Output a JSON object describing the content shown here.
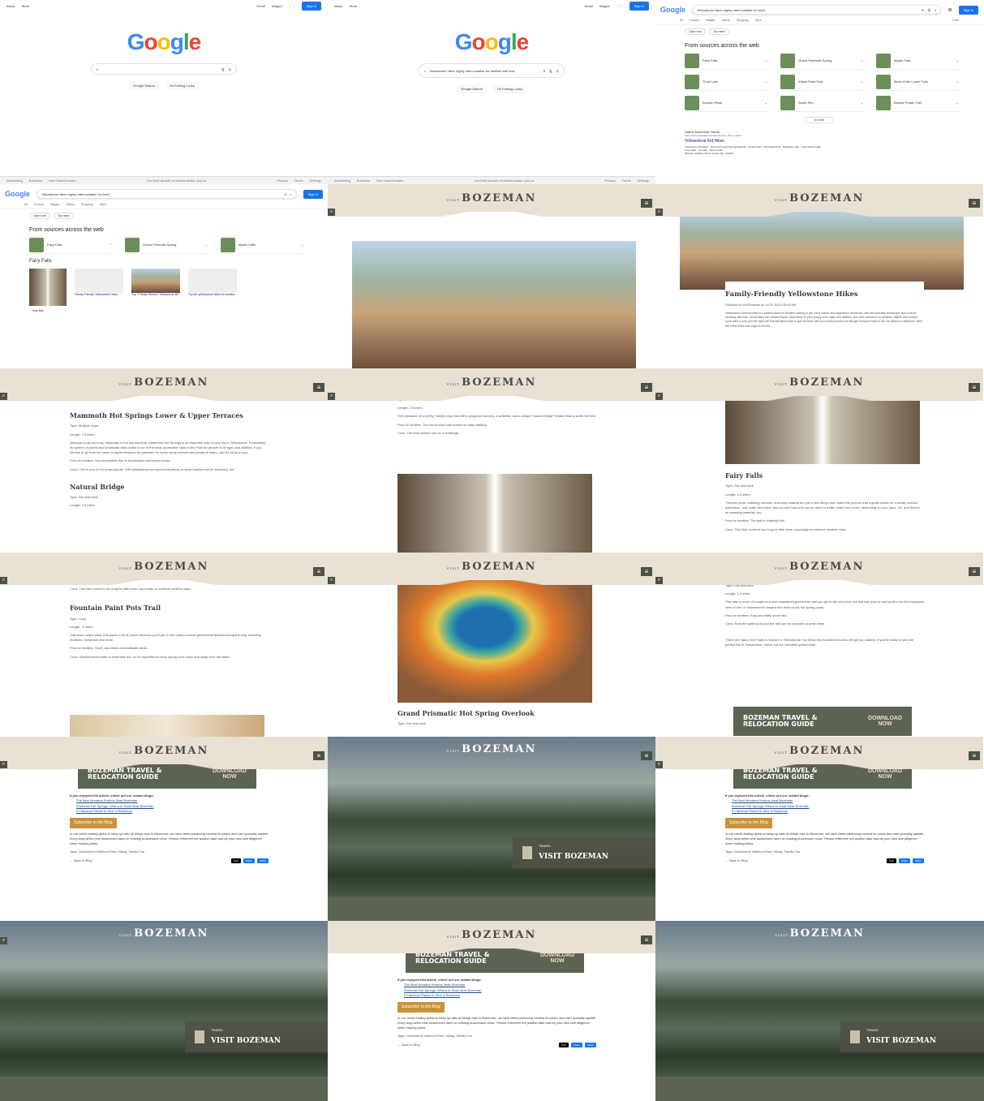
{
  "google": {
    "top_links": [
      "About",
      "Store"
    ],
    "top_right": [
      "Gmail",
      "Images"
    ],
    "sign_in": "Sign in",
    "logo": [
      "G",
      "o",
      "o",
      "g",
      "l",
      "e"
    ],
    "query": "Yellowstone hikes highly rated suitable for families with kids",
    "btn_search": "Google Search",
    "btn_lucky": "I'm Feeling Lucky",
    "footer_left": [
      "Advertising",
      "Business",
      "How Search works"
    ],
    "footer_mid": "Our third decade of climate action: join us",
    "footer_right": [
      "Privacy",
      "Terms",
      "Settings"
    ]
  },
  "results": {
    "query": "Yellowstone hikes highly rated suitable for famil",
    "tabs": [
      "All",
      "Forums",
      "Images",
      "Videos",
      "Shopping",
      "More",
      "Tools"
    ],
    "chips": [
      "Open now",
      "Top rated"
    ],
    "section": "From sources across the web",
    "items": [
      "Fairy Falls",
      "Grand Prismatic Spring",
      "Mystic Falls",
      "Trout Lake",
      "Artists Paint Pots",
      "Brink of the Lower Falls",
      "Bunsen Peak",
      "South Rim",
      "Beaver Ponds Trail"
    ],
    "more": "10 more",
    "feedback": "Feedback",
    "site": "Utah's Adventure Family",
    "url": "https://www.utahsadventurefamily.com › Blog › Hikes",
    "link": "Yellowstone Kid Hikes",
    "snippet": "Yellowstone Kid Hikes · Grand Prismatic Spring Overlook · Mystic Falls · Artist Paint Pots · Harlequin Lake · Little Gibbon Falls · Trout Lake · Ice Lake · Mystic Falls",
    "missing": "Missing: suitable | Show results with: suitable",
    "expanded": "Fairy Falls",
    "exp_cards": [
      "Family-Friendly Yellowstone Hikes",
      "Top 7 Family Hikes in Yellowstone NP",
      "Top ten yellowstone hikes for families"
    ],
    "exp_search": "fairy falls"
  },
  "boz": {
    "visit": "VISIT",
    "name": "BOZEMAN",
    "article_title": "Family-Friendly Yellowstone Hikes",
    "published": "Published by Visit Bozeman on Jul 20, 2023 9:30:00 AM",
    "intro": "Yellowstone National Park is a perfect place for families looking to get out in nature and experience Montana's wild and beautiful landscape. But if you're traveling with kids, not all hikes are created equal. Depending on your young ones' ages and abilities, plus their tolerance for weather, wildlife and crowds, you'll want to pick just the right trail that will allow them to get out there with you on the journey but still get everyone back to the car without a meltdown. Here are a few hikes that might fit the bill.",
    "h_mammoth": "Mammoth Hot Springs Lower & Upper Terraces",
    "mammoth_type": "Type: Multiple loops",
    "mammoth_len": "Length: 1.5 miles",
    "mammoth_body": "Although it can be busy, especially in the summertime, Mammoth Hot Springs is an essential stop on any trip to Yellowstone. Fortunately, its system of paved and boardwalk trails make it one of the most accessible hikes in the Park for people of all ages and abilities. If you choose to go from the lower to upper terraces, be prepared for some steep inclines and plenty of stairs—but it's all up to you.",
    "mammoth_pros": "Pros for families: Very accessible due to boardwalks and paved areas.",
    "mammoth_cons": "Cons: This is one of the most popular YNP destinations so expect that plenty of other families will be exploring, too.",
    "h_bridge": "Natural Bridge",
    "bridge_type": "Type: Out and back",
    "bridge_len": "Length: 2.5 miles",
    "bridge_body": "This pleasant, very pretty, mostly easy trail offers gorgeous scenery, a waterfall, and a unique \"natural bridge\" feature that is worth the trek.",
    "bridge_pros": "Pros for families: The old service road makes for easy walking.",
    "bridge_cons": "Cons: The final section can be a challenge.",
    "h_fairy": "Fairy Falls",
    "fairy_type": "Type: Out and back",
    "fairy_len": "Length: 4.5 miles",
    "fairy_body": "Thermal pools, bubbling streams, and easy walking are just a few things that make this popular trail a great choice for a family outdoor adventure. Just under five miles, this out and back trail can be done in a little under two hours, depending on your pace. Oh, and there's an amazing waterfall, too.",
    "fairy_pros": "Pros for families: The trail is relatively flat.",
    "fairy_cons": "Cons: This hike could be too long for little ones, especially on extreme weather days.",
    "h_fountain": "Fountain Paint Pots Trail",
    "fountain_type": "Type: Loop",
    "fountain_len": "Length: .5 miles",
    "fountain_body": "This short, super easy, trail packs a lot of punch because you'll get to see many unusual geothermal features along the way, including mudpots, fumaroles and more.",
    "fountain_pros": "Pros for families: Short, and sticks to boardwalk areas.",
    "fountain_cons": "Cons: Hydrothermal water is extremely hot, so it's important to keep young ones close and away from the water.",
    "h_prismatic": "Grand Prismatic Hot Spring Overlook",
    "prismatic_type": "Type: Out and back",
    "trout_len": "Length: 1.2 miles",
    "trout_body": "This hike is more of a walk on a well-maintained gravel trail until you get to the very end, but that last push is well worth it for the expansive view of one of Yellowstone's largest and most iconic hot spring pools.",
    "trout_pros": "Pros for families: Easy and fairly short hike.",
    "trout_cons": "Cons: Both the parking lot and the trail can be crowded at peak times.",
    "outro": "There are many more trails to explore in Yellowstone, but these few excellent choices will get you started. If you're ready to plan the perfect trip to Yellowstone, check out our complete guide today.",
    "guide_l1": "BOZEMAN TRAVEL &",
    "guide_l2": "RELOCATION GUIDE",
    "guide_d1": "DOWNLOAD",
    "guide_d2": "NOW",
    "enjoyed": "If you enjoyed this article, check out our related blogs:",
    "blog1": "The Best Montana Rodeos Near Bozeman",
    "blog2": "Bozeman Hot Springs: Where to Soak Near Bozeman",
    "blog3": "5 Fabulous Places to Dine in Bozeman",
    "subscribe": "Subscribe to the Blog",
    "disclaimer": "In our never-ending quest to keep up with all things new in Bozeman, we have been producing content for years and can't possibly update every blog when new businesses open or existing businesses close. Please reference the publish date and do your own due diligence when making plans.",
    "tags": "Tags: Yellowstone National Park, Hiking, Family Fun",
    "back": "Back to Blog",
    "share": [
      "Post",
      "Share",
      "Share"
    ],
    "travel": "TRAVEL",
    "visit_boz": "VISIT BOZEMAN"
  }
}
